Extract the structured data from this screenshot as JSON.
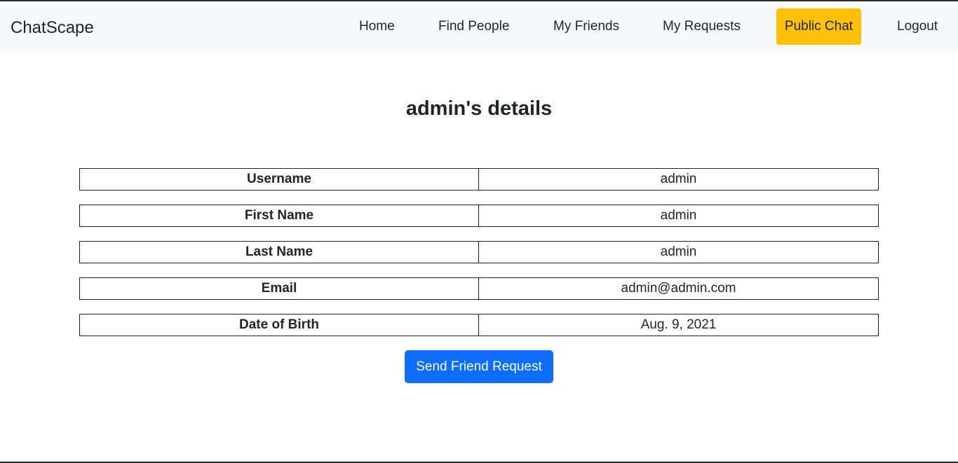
{
  "navbar": {
    "brand": "ChatScape",
    "links": [
      {
        "label": "Home"
      },
      {
        "label": "Find People"
      },
      {
        "label": "My Friends"
      },
      {
        "label": "My Requests"
      },
      {
        "label": "Public Chat",
        "highlight_color": "#ffc107"
      },
      {
        "label": "Logout"
      }
    ]
  },
  "page": {
    "title": "admin's details"
  },
  "details": [
    {
      "label": "Username",
      "value": "admin"
    },
    {
      "label": "First Name",
      "value": "admin"
    },
    {
      "label": "Last Name",
      "value": "admin"
    },
    {
      "label": "Email",
      "value": "admin@admin.com"
    },
    {
      "label": "Date of Birth",
      "value": "Aug. 9, 2021"
    }
  ],
  "actions": {
    "send_request_label": "Send Friend Request",
    "button_color": "#0d6efd"
  }
}
